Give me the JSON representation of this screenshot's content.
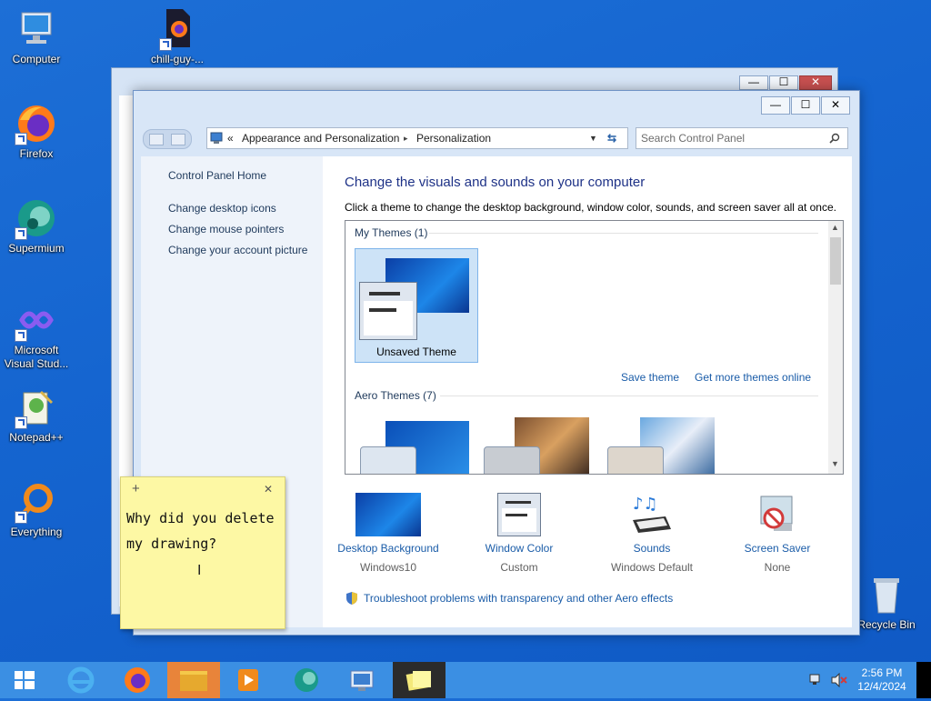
{
  "desktop": {
    "icons": [
      {
        "label": "Computer"
      },
      {
        "label": "chill-guy-..."
      },
      {
        "label": "Firefox"
      },
      {
        "label": "Supermium"
      },
      {
        "label": "Microsoft Visual Stud..."
      },
      {
        "label": "Notepad++"
      },
      {
        "label": "Everything"
      },
      {
        "label": "Recycle Bin"
      }
    ]
  },
  "window": {
    "caption_buttons": {
      "minimize": "—",
      "maximize": "☐",
      "close": "✕"
    },
    "address": {
      "prefix": "«",
      "crumb1": "Appearance and Personalization",
      "sep": "▸",
      "crumb2": "Personalization"
    },
    "search_placeholder": "Search Control Panel",
    "help": "?",
    "left_links": {
      "home": "Control Panel Home",
      "desktop_icons": "Change desktop icons",
      "mouse_pointers": "Change mouse pointers",
      "account_picture": "Change your account picture"
    },
    "heading": "Change the visuals and sounds on your computer",
    "subheading": "Click a theme to change the desktop background, window color, sounds, and screen saver all at once.",
    "my_themes_header": "My Themes (1)",
    "unsaved_theme": "Unsaved Theme",
    "save_theme": "Save theme",
    "get_more": "Get more themes online",
    "aero_header": "Aero Themes (7)",
    "bottom": {
      "background": {
        "title": "Desktop Background",
        "value": "Windows10"
      },
      "color": {
        "title": "Window Color",
        "value": "Custom"
      },
      "sounds": {
        "title": "Sounds",
        "value": "Windows Default"
      },
      "saver": {
        "title": "Screen Saver",
        "value": "None"
      }
    },
    "troubleshoot": "Troubleshoot problems with transparency and other Aero effects"
  },
  "sticky": {
    "add": "+",
    "close": "✕",
    "line1": "Why did you delete",
    "line2": "my drawing?"
  },
  "taskbar": {
    "time": "2:56 PM",
    "date": "12/4/2024"
  },
  "colors": {
    "desktop": "#1565d0",
    "taskbar": "#3b8fe3",
    "link": "#1a5ca8",
    "heading": "#1e3287",
    "sticky": "#fdf8a4"
  }
}
